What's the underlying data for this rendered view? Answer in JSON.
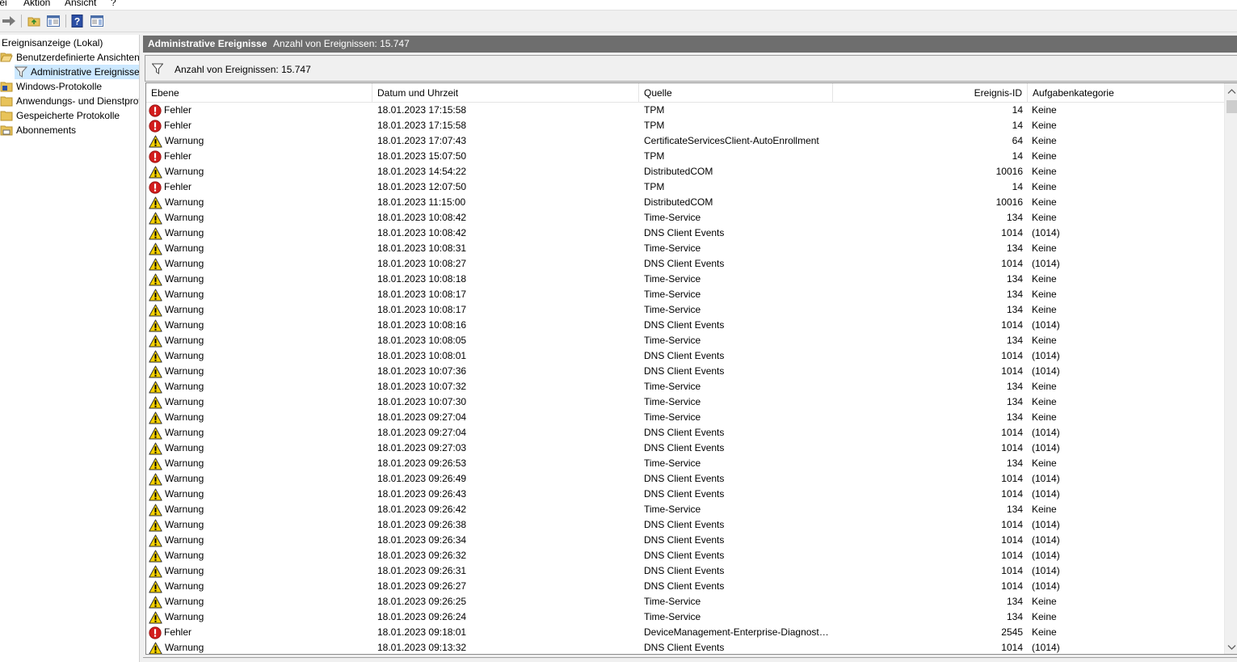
{
  "menu": [
    "tei",
    "Aktion",
    "Ansicht",
    "?"
  ],
  "tree": {
    "root": "Ereignisanzeige (Lokal)",
    "items": [
      {
        "label": "Benutzerdefinierte Ansichten"
      },
      {
        "label": "Administrative Ereignisse"
      },
      {
        "label": "Windows-Protokolle"
      },
      {
        "label": "Anwendungs- und Dienstprotokolle"
      },
      {
        "label": "Gespeicherte Protokolle"
      },
      {
        "label": "Abonnements"
      }
    ]
  },
  "panel": {
    "title": "Administrative Ereignisse",
    "count_header": "Anzahl von Ereignissen: 15.747",
    "filter_text": "Anzahl von Ereignissen: 15.747"
  },
  "columns": {
    "level": "Ebene",
    "date": "Datum und Uhrzeit",
    "source": "Quelle",
    "id": "Ereignis-ID",
    "category": "Aufgabenkategorie"
  },
  "colors": {
    "error": "#d21c1c",
    "warning": "#f5d000",
    "selection": "#cce8ff",
    "header_bar": "#6e6e6e"
  },
  "icons": {
    "error": "error-icon",
    "warning": "warning-icon",
    "filter": "filter-icon",
    "folder": "folder-icon"
  },
  "events": [
    {
      "level": "Fehler",
      "type": "error",
      "date": "18.01.2023 17:15:58",
      "source": "TPM",
      "id": "14",
      "category": "Keine"
    },
    {
      "level": "Fehler",
      "type": "error",
      "date": "18.01.2023 17:15:58",
      "source": "TPM",
      "id": "14",
      "category": "Keine"
    },
    {
      "level": "Warnung",
      "type": "warning",
      "date": "18.01.2023 17:07:43",
      "source": "CertificateServicesClient-AutoEnrollment",
      "id": "64",
      "category": "Keine"
    },
    {
      "level": "Fehler",
      "type": "error",
      "date": "18.01.2023 15:07:50",
      "source": "TPM",
      "id": "14",
      "category": "Keine"
    },
    {
      "level": "Warnung",
      "type": "warning",
      "date": "18.01.2023 14:54:22",
      "source": "DistributedCOM",
      "id": "10016",
      "category": "Keine"
    },
    {
      "level": "Fehler",
      "type": "error",
      "date": "18.01.2023 12:07:50",
      "source": "TPM",
      "id": "14",
      "category": "Keine"
    },
    {
      "level": "Warnung",
      "type": "warning",
      "date": "18.01.2023 11:15:00",
      "source": "DistributedCOM",
      "id": "10016",
      "category": "Keine"
    },
    {
      "level": "Warnung",
      "type": "warning",
      "date": "18.01.2023 10:08:42",
      "source": "Time-Service",
      "id": "134",
      "category": "Keine"
    },
    {
      "level": "Warnung",
      "type": "warning",
      "date": "18.01.2023 10:08:42",
      "source": "DNS Client Events",
      "id": "1014",
      "category": "(1014)"
    },
    {
      "level": "Warnung",
      "type": "warning",
      "date": "18.01.2023 10:08:31",
      "source": "Time-Service",
      "id": "134",
      "category": "Keine"
    },
    {
      "level": "Warnung",
      "type": "warning",
      "date": "18.01.2023 10:08:27",
      "source": "DNS Client Events",
      "id": "1014",
      "category": "(1014)"
    },
    {
      "level": "Warnung",
      "type": "warning",
      "date": "18.01.2023 10:08:18",
      "source": "Time-Service",
      "id": "134",
      "category": "Keine"
    },
    {
      "level": "Warnung",
      "type": "warning",
      "date": "18.01.2023 10:08:17",
      "source": "Time-Service",
      "id": "134",
      "category": "Keine"
    },
    {
      "level": "Warnung",
      "type": "warning",
      "date": "18.01.2023 10:08:17",
      "source": "Time-Service",
      "id": "134",
      "category": "Keine"
    },
    {
      "level": "Warnung",
      "type": "warning",
      "date": "18.01.2023 10:08:16",
      "source": "DNS Client Events",
      "id": "1014",
      "category": "(1014)"
    },
    {
      "level": "Warnung",
      "type": "warning",
      "date": "18.01.2023 10:08:05",
      "source": "Time-Service",
      "id": "134",
      "category": "Keine"
    },
    {
      "level": "Warnung",
      "type": "warning",
      "date": "18.01.2023 10:08:01",
      "source": "DNS Client Events",
      "id": "1014",
      "category": "(1014)"
    },
    {
      "level": "Warnung",
      "type": "warning",
      "date": "18.01.2023 10:07:36",
      "source": "DNS Client Events",
      "id": "1014",
      "category": "(1014)"
    },
    {
      "level": "Warnung",
      "type": "warning",
      "date": "18.01.2023 10:07:32",
      "source": "Time-Service",
      "id": "134",
      "category": "Keine"
    },
    {
      "level": "Warnung",
      "type": "warning",
      "date": "18.01.2023 10:07:30",
      "source": "Time-Service",
      "id": "134",
      "category": "Keine"
    },
    {
      "level": "Warnung",
      "type": "warning",
      "date": "18.01.2023 09:27:04",
      "source": "Time-Service",
      "id": "134",
      "category": "Keine"
    },
    {
      "level": "Warnung",
      "type": "warning",
      "date": "18.01.2023 09:27:04",
      "source": "DNS Client Events",
      "id": "1014",
      "category": "(1014)"
    },
    {
      "level": "Warnung",
      "type": "warning",
      "date": "18.01.2023 09:27:03",
      "source": "DNS Client Events",
      "id": "1014",
      "category": "(1014)"
    },
    {
      "level": "Warnung",
      "type": "warning",
      "date": "18.01.2023 09:26:53",
      "source": "Time-Service",
      "id": "134",
      "category": "Keine"
    },
    {
      "level": "Warnung",
      "type": "warning",
      "date": "18.01.2023 09:26:49",
      "source": "DNS Client Events",
      "id": "1014",
      "category": "(1014)"
    },
    {
      "level": "Warnung",
      "type": "warning",
      "date": "18.01.2023 09:26:43",
      "source": "DNS Client Events",
      "id": "1014",
      "category": "(1014)"
    },
    {
      "level": "Warnung",
      "type": "warning",
      "date": "18.01.2023 09:26:42",
      "source": "Time-Service",
      "id": "134",
      "category": "Keine"
    },
    {
      "level": "Warnung",
      "type": "warning",
      "date": "18.01.2023 09:26:38",
      "source": "DNS Client Events",
      "id": "1014",
      "category": "(1014)"
    },
    {
      "level": "Warnung",
      "type": "warning",
      "date": "18.01.2023 09:26:34",
      "source": "DNS Client Events",
      "id": "1014",
      "category": "(1014)"
    },
    {
      "level": "Warnung",
      "type": "warning",
      "date": "18.01.2023 09:26:32",
      "source": "DNS Client Events",
      "id": "1014",
      "category": "(1014)"
    },
    {
      "level": "Warnung",
      "type": "warning",
      "date": "18.01.2023 09:26:31",
      "source": "DNS Client Events",
      "id": "1014",
      "category": "(1014)"
    },
    {
      "level": "Warnung",
      "type": "warning",
      "date": "18.01.2023 09:26:27",
      "source": "DNS Client Events",
      "id": "1014",
      "category": "(1014)"
    },
    {
      "level": "Warnung",
      "type": "warning",
      "date": "18.01.2023 09:26:25",
      "source": "Time-Service",
      "id": "134",
      "category": "Keine"
    },
    {
      "level": "Warnung",
      "type": "warning",
      "date": "18.01.2023 09:26:24",
      "source": "Time-Service",
      "id": "134",
      "category": "Keine"
    },
    {
      "level": "Fehler",
      "type": "error",
      "date": "18.01.2023 09:18:01",
      "source": "DeviceManagement-Enterprise-Diagnostics-Provider",
      "id": "2545",
      "category": "Keine"
    },
    {
      "level": "Warnung",
      "type": "warning",
      "date": "18.01.2023 09:13:32",
      "source": "DNS Client Events",
      "id": "1014",
      "category": "(1014)"
    }
  ]
}
